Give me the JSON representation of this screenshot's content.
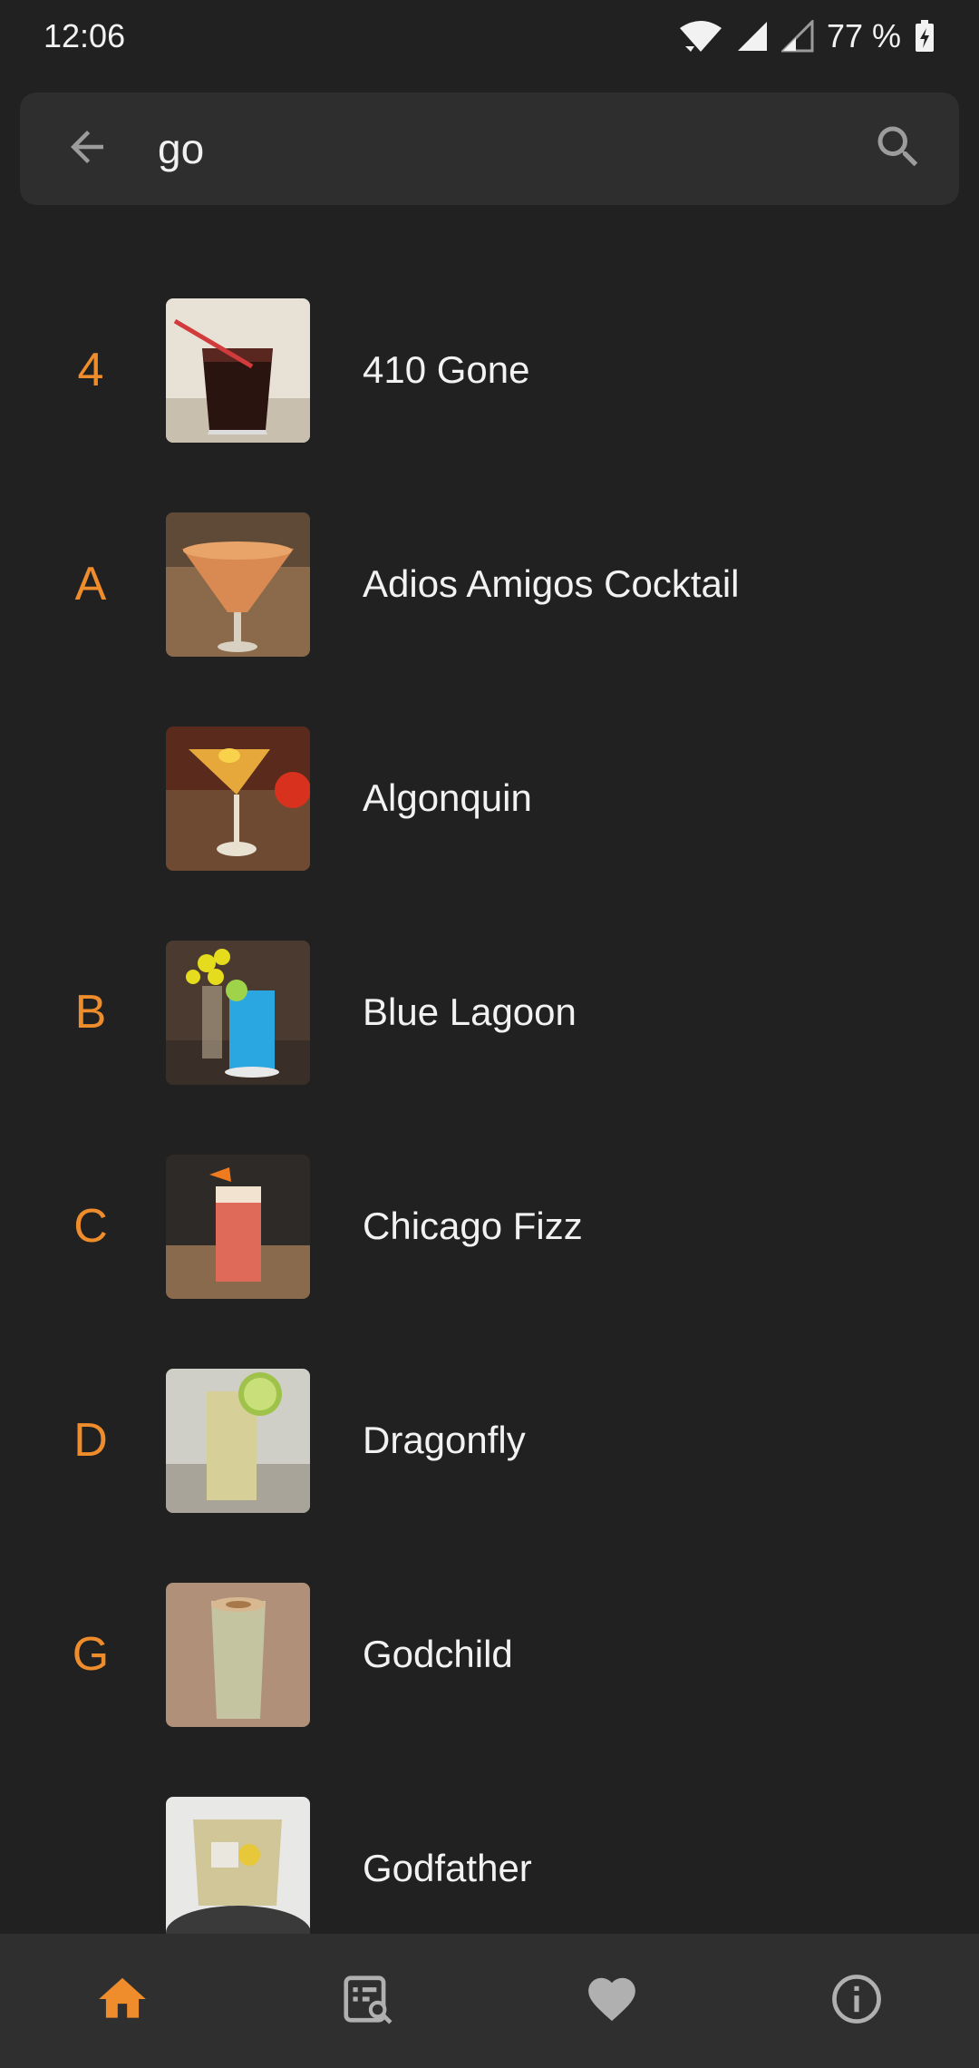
{
  "status_bar": {
    "time": "12:06",
    "battery": "77 %",
    "icons": [
      "wifi-icon",
      "signal-icon",
      "signal-weak-icon",
      "battery-charging-icon"
    ]
  },
  "search": {
    "query": "go",
    "back_icon": "arrow-left-icon",
    "search_icon": "search-icon"
  },
  "results": [
    {
      "section": "4",
      "name": "410 Gone",
      "thumb": "dark cola cocktail with red straw"
    },
    {
      "section": "A",
      "name": "Adios Amigos Cocktail",
      "thumb": "orange martini glass"
    },
    {
      "section": "",
      "name": "Algonquin",
      "thumb": "golden martini with lemon twist"
    },
    {
      "section": "B",
      "name": "Blue Lagoon",
      "thumb": "blue drink with lime and yellow flowers"
    },
    {
      "section": "C",
      "name": "Chicago Fizz",
      "thumb": "red highball with orange peel"
    },
    {
      "section": "D",
      "name": "Dragonfly",
      "thumb": "pale highball with lime wheel"
    },
    {
      "section": "G",
      "name": "Godchild",
      "thumb": "creamy drink with nutmeg"
    },
    {
      "section": "",
      "name": "Godfather",
      "thumb": "whisky on the rocks with lemon"
    }
  ],
  "bottom_nav": [
    {
      "name": "home",
      "icon": "home-icon",
      "active": true
    },
    {
      "name": "search-list",
      "icon": "list-search-icon",
      "active": false
    },
    {
      "name": "favorites",
      "icon": "heart-icon",
      "active": false
    },
    {
      "name": "info",
      "icon": "info-icon",
      "active": false
    }
  ],
  "colors": {
    "background": "#212121",
    "search_bar": "#2e2e2e",
    "accent": "#ef8c2b",
    "text": "#f2f2f2",
    "icon_inactive": "#b0b0b0",
    "nav_background": "#2f2f30"
  }
}
